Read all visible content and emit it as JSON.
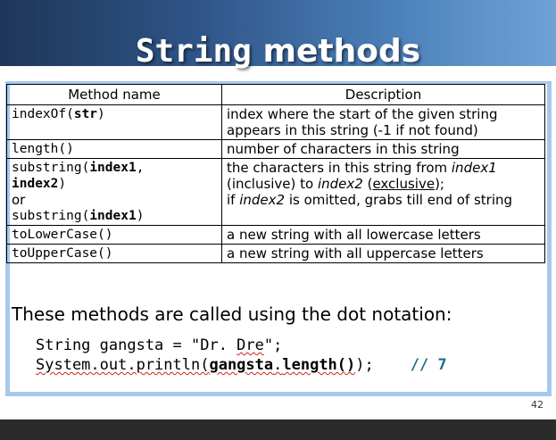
{
  "title": {
    "mono": "String",
    "rest": " methods"
  },
  "table": {
    "headers": [
      "Method name",
      "Description"
    ],
    "rows": [
      {
        "method": {
          "pre": "indexOf(",
          "bold": "str",
          "post": ")"
        },
        "desc": {
          "line1": "index where the start of the given string",
          "line2": "appears in this string (-1 if not found)"
        }
      },
      {
        "method": {
          "text": "length()"
        },
        "desc": {
          "text": "number of characters in this string"
        }
      },
      {
        "method": {
          "pre1": "substring(",
          "bold1": "index1",
          "comma": ",",
          "bold2": "index2",
          "close": ")",
          "or": "or",
          "pre2": "substring(",
          "bold3": "index1",
          "close2": ")"
        },
        "desc": {
          "a1": "the characters in this string from ",
          "a1i": "index1",
          "a2": "(inclusive) to ",
          "a2i": "index2",
          "a2sp": " (",
          "a2u": "exclusive",
          "a2end": ");",
          "a3": "if ",
          "a3i": "index2",
          "a3rest": " is omitted, grabs till end of string"
        }
      },
      {
        "method": {
          "text": "toLowerCase()"
        },
        "desc": {
          "text": "a new string with all lowercase letters"
        }
      },
      {
        "method": {
          "text": "toUpperCase()"
        },
        "desc": {
          "text": "a new string with all uppercase letters"
        }
      }
    ]
  },
  "note": "These methods are called using the dot notation:",
  "code": {
    "line1_pre": "String gangsta = \"Dr. ",
    "line1_sq": "Dre",
    "line1_post": "\";",
    "line2_a": "System.out.println(",
    "line2_b": "gangsta",
    "line2_c": ".",
    "line2_d": "length()",
    "line2_e": ");",
    "comment": "// 7"
  },
  "page_number": "42"
}
